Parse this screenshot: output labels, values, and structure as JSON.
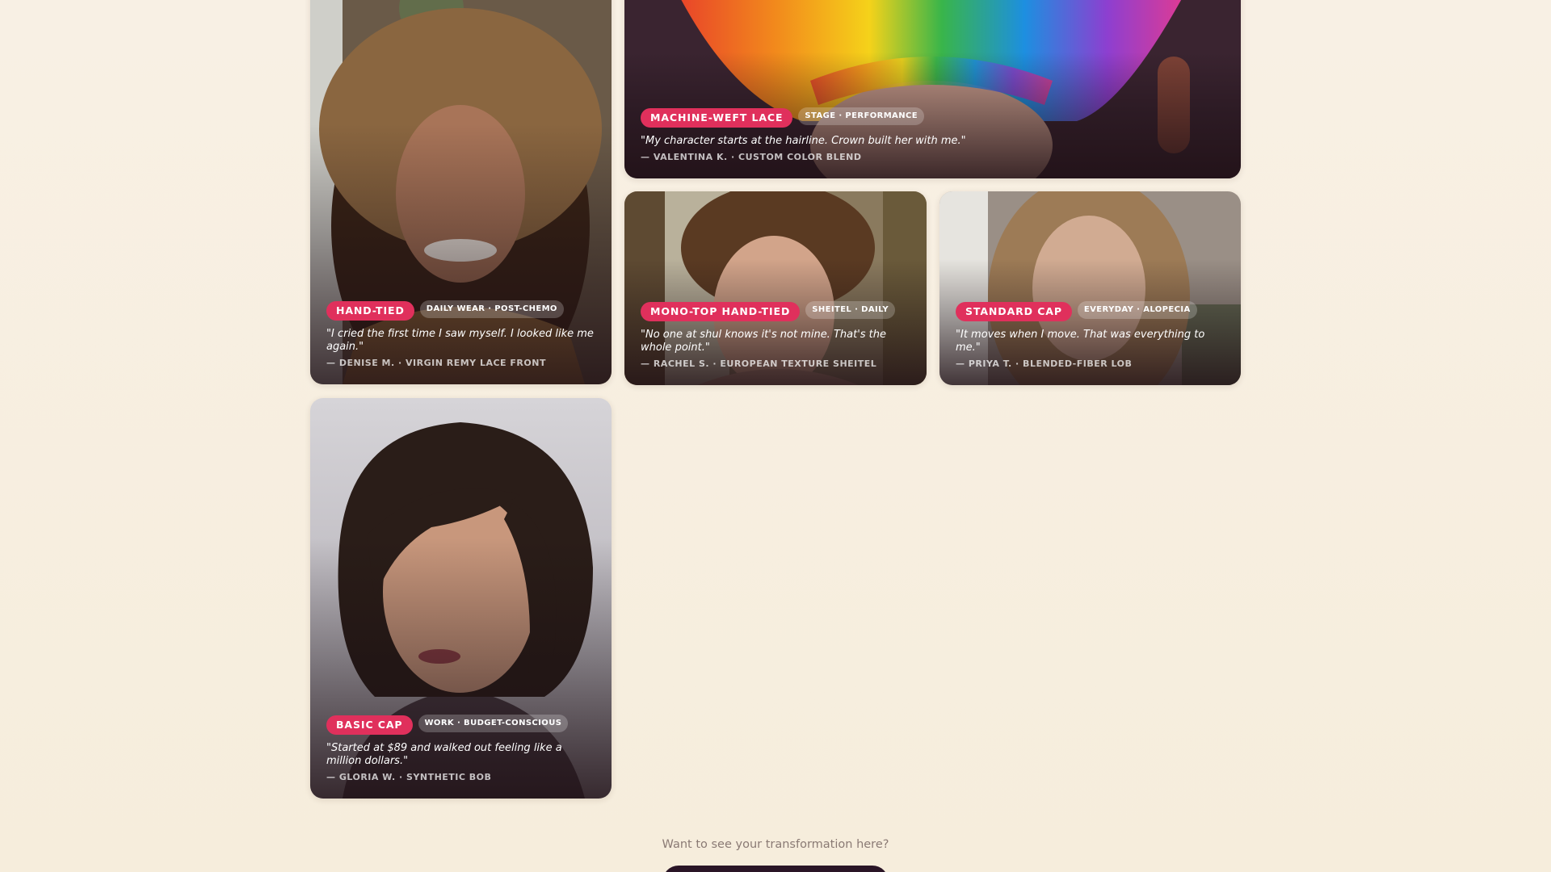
{
  "cards": [
    {
      "primary_tag": "HAND-TIED",
      "secondary_tag": "DAILY WEAR · POST-CHEMO",
      "quote": "\"I cried the first time I saw myself. I looked like me again.\"",
      "attribution": "— DENISE M. · VIRGIN REMY LACE FRONT"
    },
    {
      "primary_tag": "MACHINE-WEFT LACE",
      "secondary_tag": "STAGE · PERFORMANCE",
      "quote": "\"My character starts at the hairline. Crown built her with me.\"",
      "attribution": "— VALENTINA K. · CUSTOM COLOR BLEND"
    },
    {
      "primary_tag": "MONO-TOP HAND-TIED",
      "secondary_tag": "SHEITEL · DAILY",
      "quote": "\"No one at shul knows it's not mine. That's the whole point.\"",
      "attribution": "— RACHEL S. · EUROPEAN TEXTURE SHEITEL"
    },
    {
      "primary_tag": "STANDARD CAP",
      "secondary_tag": "EVERYDAY · ALOPECIA",
      "quote": "\"It moves when I move. That was everything to me.\"",
      "attribution": "— PRIYA T. · BLENDED-FIBER LOB"
    },
    {
      "primary_tag": "BASIC CAP",
      "secondary_tag": "WORK · BUDGET-CONSCIOUS",
      "quote": "\"Started at $89 and walked out feeling like a million dollars.\"",
      "attribution": "— GLORIA W. · SYNTHETIC BOB"
    }
  ],
  "cta": {
    "prompt": "Want to see your transformation here?"
  },
  "colors": {
    "accent": "#e0305c",
    "background": "#f8f0e4",
    "cta_button": "#2a1526"
  }
}
